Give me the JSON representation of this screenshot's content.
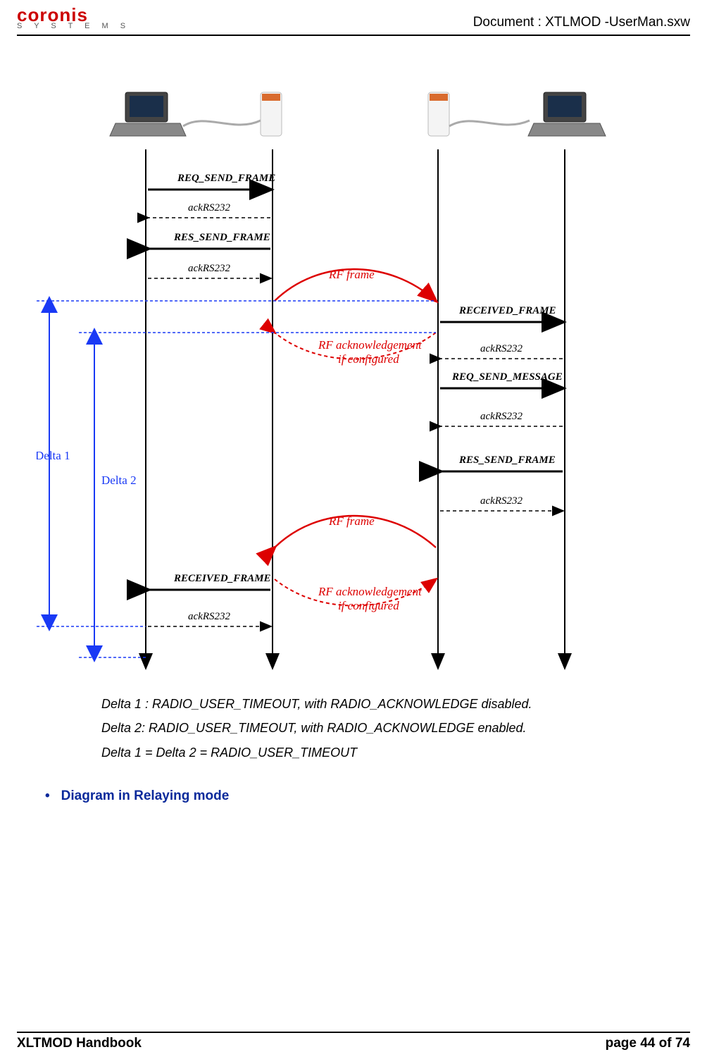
{
  "header": {
    "logo_top": "coronis",
    "logo_bottom": "S Y S T E M S",
    "doc_id": "Document : XTLMOD -UserMan.sxw"
  },
  "diagram": {
    "left": {
      "msgs": [
        {
          "label": "REQ_SEND_FRAME",
          "dir": "r",
          "style": "bold"
        },
        {
          "label": "ackRS232",
          "dir": "l",
          "style": "it",
          "dashed": true
        },
        {
          "label": "RES_SEND_FRAME",
          "dir": "l",
          "style": "bold"
        },
        {
          "label": "ackRS232",
          "dir": "r",
          "style": "it",
          "dashed": true
        },
        {
          "label": "RECEIVED_FRAME",
          "dir": "l",
          "style": "bold"
        },
        {
          "label": "ackRS232",
          "dir": "r",
          "style": "it",
          "dashed": true
        }
      ]
    },
    "rf": [
      {
        "label": "RF frame",
        "sub": "RF acknowledgement if configured"
      },
      {
        "label": "RF frame",
        "sub": "RF acknowledgement if configured"
      }
    ],
    "right": {
      "msgs": [
        {
          "label": "RECEIVED_FRAME",
          "dir": "r",
          "style": "bold"
        },
        {
          "label": "ackRS232",
          "dir": "l",
          "style": "it",
          "dashed": true
        },
        {
          "label": "REQ_SEND_MESSAGE",
          "dir": "r",
          "style": "bold"
        },
        {
          "label": "ackRS232",
          "dir": "l",
          "style": "it",
          "dashed": true
        },
        {
          "label": "RES_SEND_FRAME",
          "dir": "l",
          "style": "bold"
        },
        {
          "label": "ackRS232",
          "dir": "r",
          "style": "it",
          "dashed": true
        }
      ]
    },
    "deltas": {
      "d1": "Delta 1",
      "d2": "Delta 2"
    }
  },
  "captions": {
    "c1": "Delta 1 :  RADIO_USER_TIMEOUT, with RADIO_ACKNOWLEDGE disabled.",
    "c2": "Delta 2:  RADIO_USER_TIMEOUT, with RADIO_ACKNOWLEDGE enabled.",
    "c3": "Delta 1  = Delta 2  = RADIO_USER_TIMEOUT"
  },
  "bullet": "Diagram in Relaying mode",
  "footer": {
    "left": "XLTMOD Handbook",
    "right": "page 44 of 74"
  }
}
